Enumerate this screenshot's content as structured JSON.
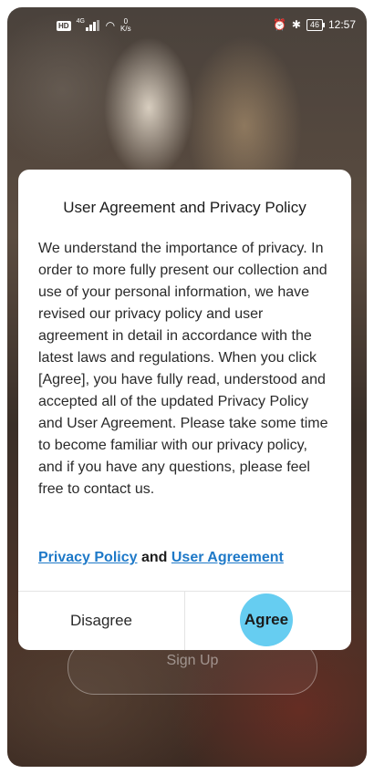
{
  "status_bar": {
    "hd_label": "HD",
    "network_gen": "4G",
    "speed_value": "0",
    "speed_unit": "K/s",
    "battery": "46",
    "time": "12:57",
    "icons": [
      "signal-icon",
      "wifi-icon",
      "alarm-icon",
      "bluetooth-icon",
      "battery-icon"
    ]
  },
  "background": {
    "signup_label": "Sign Up"
  },
  "dialog": {
    "title": "User Agreement and Privacy Policy",
    "body": "We understand the importance of privacy. In order to more fully present our collection and use of your personal information, we have revised our privacy policy and user agreement in detail in accordance with the latest laws and regulations. When you click [Agree], you have fully read, understood and accepted all of the updated Privacy Policy and User Agreement. Please take some time to become familiar with our privacy policy, and if you have any questions, please feel free to contact us.",
    "privacy_link": "Privacy Policy",
    "and_text": "and",
    "user_agreement_link": "User Agreement",
    "disagree_label": "Disagree",
    "agree_label": "Agree"
  },
  "colors": {
    "link": "#1e79c8",
    "agree_highlight": "#66cdf1"
  }
}
